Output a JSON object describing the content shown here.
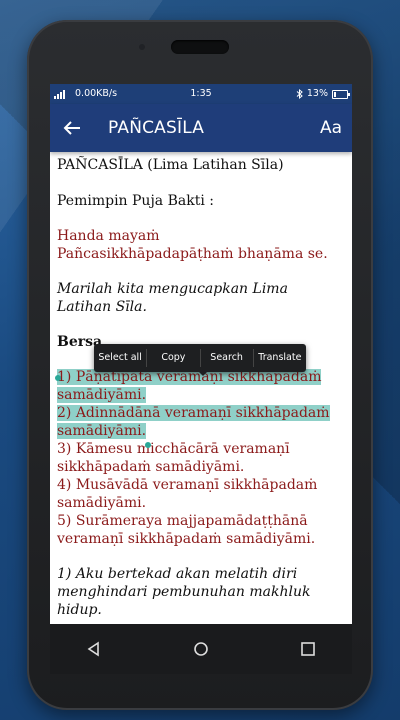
{
  "status_bar": {
    "network_speed": "0.00KB/s",
    "time": "1:35",
    "battery": "13%"
  },
  "app_bar": {
    "title": "PAÑCASĪLA",
    "font_button": "Aa"
  },
  "content": {
    "heading": "PAÑCASĪLA (Lima Latihan Sīla)",
    "leader": "Pemimpin Puja Bakti :",
    "pali_intro_1": "Handa mayaṁ",
    "pali_intro_2": "Pañcasikkhāpadapāṭhaṁ bhaṇāma se.",
    "indo_intro_1": "Marilah kita mengucapkan Lima",
    "indo_intro_2": "Latihan Sīla.",
    "together_partial": "Bersa",
    "precepts": [
      "1) Pāṇātipātā veramaṇī sikkhāpadaṁ",
      "samādiyāmi.",
      "2) Adinnādānā veramaṇī sikkhāpadaṁ",
      "samādiyāmi.",
      "3) Kāmesu micchācārā veramaṇī",
      "sikkhāpadaṁ samādiyāmi.",
      "4) Musāvādā veramaṇī sikkhāpadaṁ",
      "samādiyāmi.",
      "5) Surāmeraya majjapamādaṭṭhānā",
      "veramaṇī sikkhāpadaṁ samādiyāmi."
    ],
    "translation": [
      "1) Aku bertekad akan melatih diri",
      "menghindari pembunuhan makhluk",
      "hidup."
    ]
  },
  "context_menu": {
    "select_all": "Select all",
    "copy": "Copy",
    "search": "Search",
    "translate": "Translate"
  },
  "icons": {
    "back": "arrow-back-icon",
    "nav_back": "triangle-back-icon",
    "nav_home": "circle-home-icon",
    "nav_recents": "square-recents-icon"
  },
  "colors": {
    "app_bar": "#1f3d7a",
    "pali_text": "#8b1a1a",
    "selection": "#8fd0c8"
  }
}
